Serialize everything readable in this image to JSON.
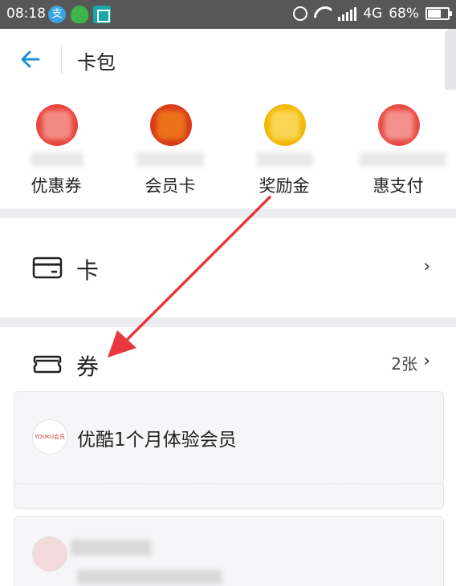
{
  "status_bar": {
    "time": "08:18",
    "network": "4G",
    "battery": "68%",
    "battery_level": 0.68,
    "icons": [
      "alipay-icon",
      "shield-icon",
      "scan-icon",
      "alarm-icon",
      "wifi-icon",
      "signal-icon",
      "battery-icon"
    ]
  },
  "header": {
    "title": "卡包",
    "back_icon": "arrow-left-icon"
  },
  "quick_items": [
    {
      "label": "优惠券",
      "color": "#e8453c"
    },
    {
      "label": "会员卡",
      "color": "#d93a1a"
    },
    {
      "label": "奖励金",
      "color": "#f2b705"
    },
    {
      "label": "惠支付",
      "color": "#e84b44"
    }
  ],
  "card_row": {
    "label": "卡",
    "icon": "card-icon"
  },
  "coupon_row": {
    "label": "券",
    "count": "2张",
    "icon": "ticket-icon"
  },
  "coupons": [
    {
      "logo": "YOUKU会员",
      "title": "优酷1个月体验会员"
    }
  ],
  "colors": {
    "accent": "#1a8fd8",
    "annotation_arrow": "#e8383d"
  }
}
